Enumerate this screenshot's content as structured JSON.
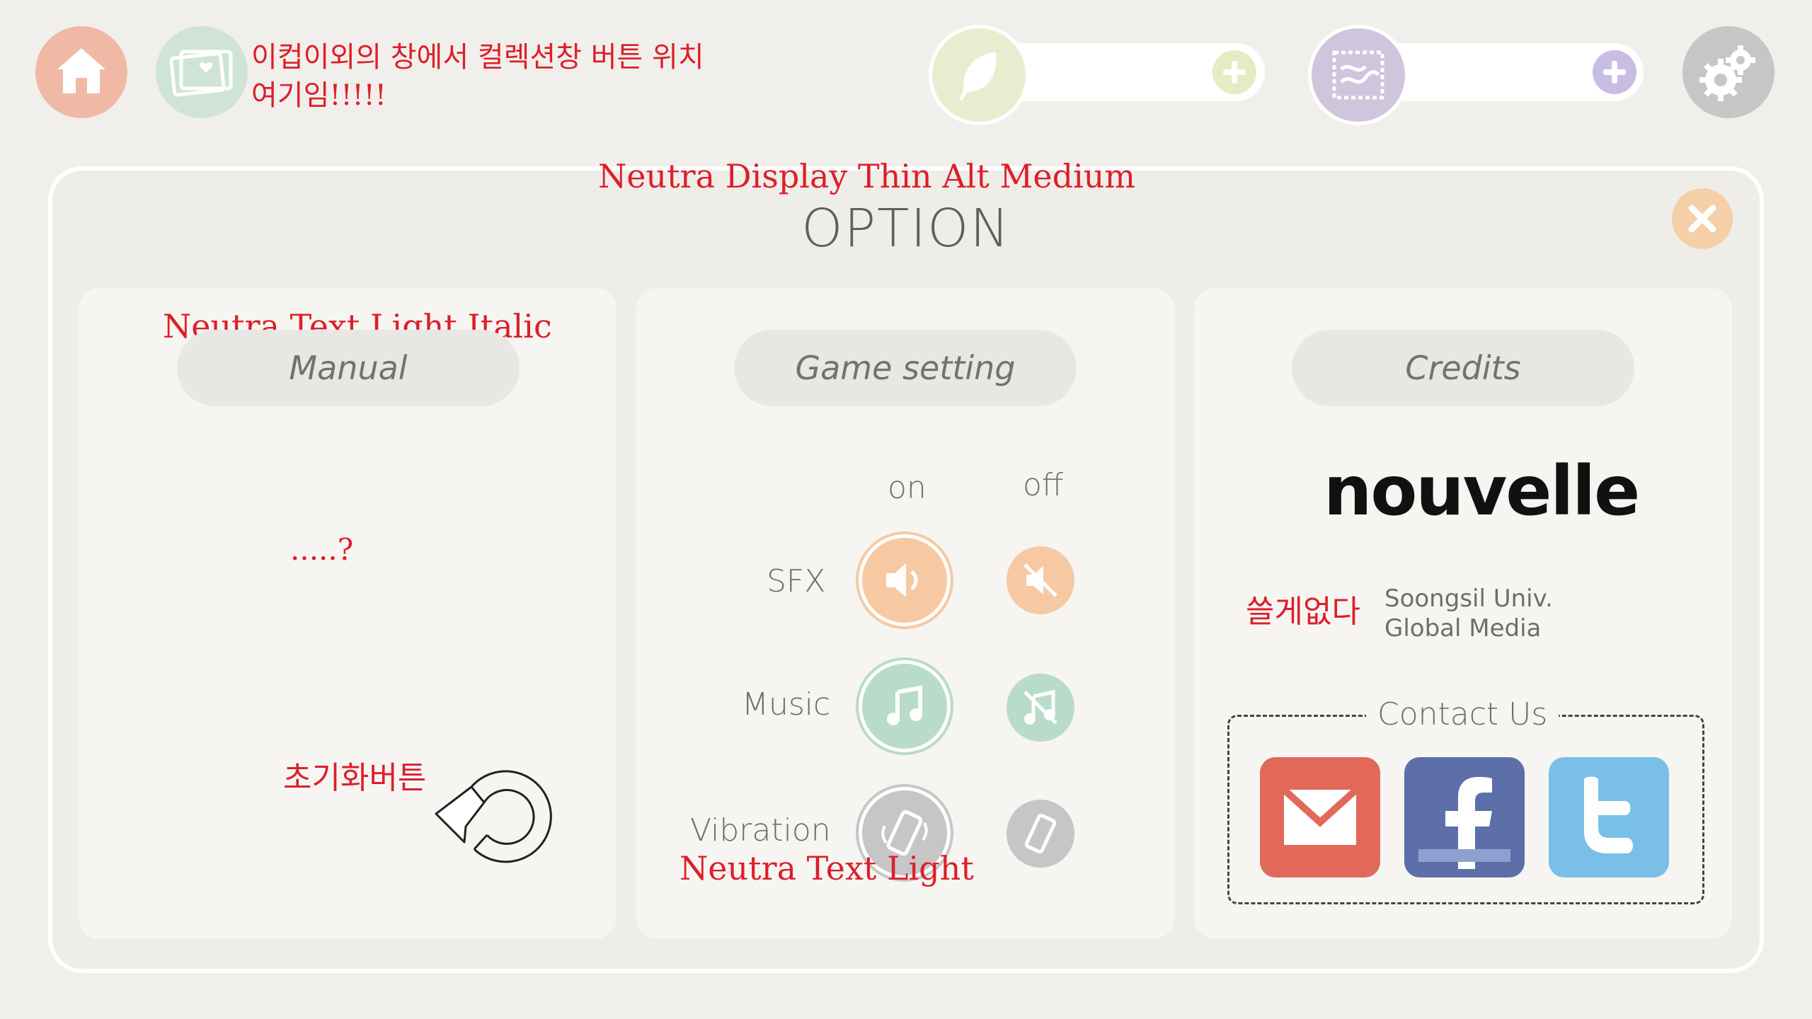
{
  "topbar": {
    "home_icon": "home-icon",
    "album_icon": "photo-album-icon",
    "settings_icon": "gear-icon",
    "currency1_icon": "feather-icon",
    "currency2_icon": "stamp-icon",
    "note_line1": "이컵이외의 창에서 컬렉션창 버튼 위치",
    "note_line2": "여기임!!!!!"
  },
  "panel": {
    "title": "OPTION",
    "title_font_note": "Neutra Display Thin Alt Medium",
    "close_icon": "close-icon"
  },
  "manual": {
    "label": "Manual",
    "font_note": "Neutra Text Light Italic",
    "question_note": ".....?",
    "reset_note": "초기화버튼",
    "reset_icon": "reset-icon"
  },
  "game_setting": {
    "label": "Game setting",
    "on_label": "on",
    "off_label": "off",
    "sfx_label": "SFX",
    "music_label": "Music",
    "vibration_label": "Vibration",
    "font_note": "Neutra Text Light"
  },
  "credits": {
    "label": "Credits",
    "brand": "nouvelle",
    "org_line1": "Soongsil Univ.",
    "org_line2": "Global Media",
    "note": "쓸게없다",
    "contact_label": "Contact Us"
  },
  "colors": {
    "home": "#f0b9a6",
    "album": "#cfe3d6",
    "feather": "#e9edd0",
    "stamp": "#cfc6de",
    "sfx": "#f6c9a3",
    "music": "#b9dbc9",
    "vibration": "#c6c6c6",
    "email": "#e2695a",
    "facebook": "#5c6fa8",
    "twitter": "#79bfe8"
  }
}
